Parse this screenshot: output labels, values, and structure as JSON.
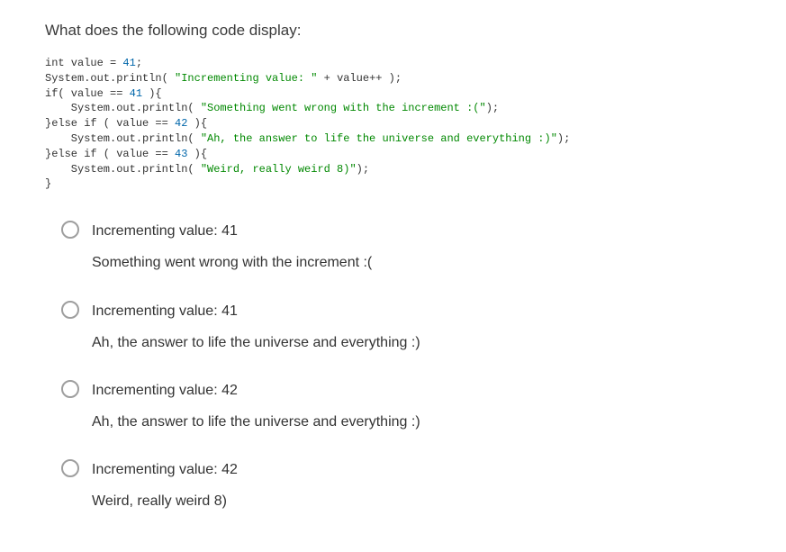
{
  "question": "What does the following code display:",
  "code": {
    "l1a": "int value = ",
    "l1b": "41",
    "l1c": ";",
    "l2a": "System.out.println( ",
    "l2b": "\"Incrementing value: \"",
    "l2c": " + value++ );",
    "l3a": "if( value == ",
    "l3b": "41",
    "l3c": " ){",
    "l4a": "    System.out.println( ",
    "l4b": "\"Something went wrong with the increment :(\"",
    "l4c": ");",
    "l5a": "}else if ( value == ",
    "l5b": "42",
    "l5c": " ){",
    "l6a": "    System.out.println( ",
    "l6b": "\"Ah, the answer to life the universe and everything :)\"",
    "l6c": ");",
    "l7a": "}else if ( value == ",
    "l7b": "43",
    "l7c": " ){",
    "l8a": "    System.out.println( ",
    "l8b": "\"Weird, really weird 8)\"",
    "l8c": ");",
    "l9": "}"
  },
  "options": [
    {
      "line1": "Incrementing value: 41",
      "line2": "Something went wrong with the increment :("
    },
    {
      "line1": "Incrementing value: 41",
      "line2": "Ah, the answer to life the universe and everything :)"
    },
    {
      "line1": "Incrementing value: 42",
      "line2": "Ah, the answer to life the universe and everything :)"
    },
    {
      "line1": "Incrementing value: 42",
      "line2": "Weird, really weird 8)"
    }
  ]
}
